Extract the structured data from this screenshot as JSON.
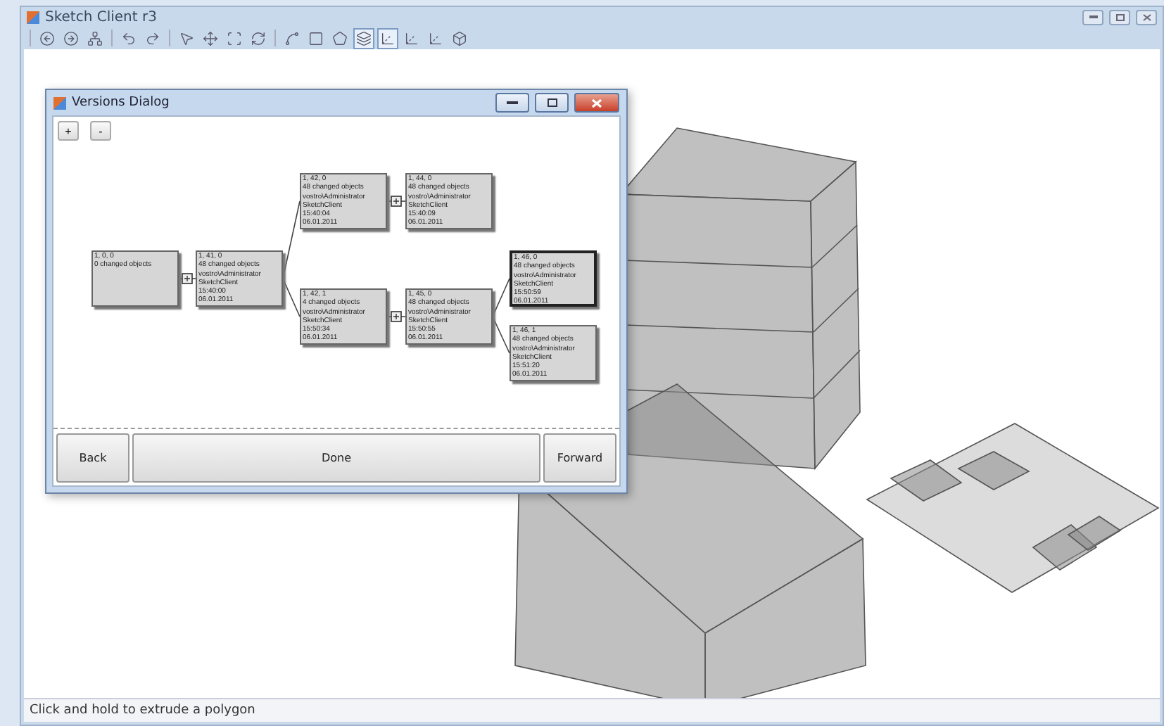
{
  "window": {
    "title": "Sketch Client r3"
  },
  "toolbar": [
    [
      {
        "kind": "back",
        "pressed": false
      },
      {
        "kind": "forward",
        "pressed": false
      },
      {
        "kind": "hierarchy",
        "pressed": false
      }
    ],
    [
      {
        "kind": "undo",
        "pressed": false
      },
      {
        "kind": "redo",
        "pressed": false
      }
    ],
    [
      {
        "kind": "pointer",
        "pressed": false
      },
      {
        "kind": "move",
        "pressed": false
      },
      {
        "kind": "fit",
        "pressed": false
      },
      {
        "kind": "rotate",
        "pressed": false
      }
    ],
    [
      {
        "kind": "freehand",
        "pressed": false
      },
      {
        "kind": "rectangle",
        "pressed": false
      },
      {
        "kind": "polygon",
        "pressed": false
      },
      {
        "kind": "layers",
        "pressed": true
      },
      {
        "kind": "axis",
        "pressed": true
      },
      {
        "kind": "axis",
        "pressed": false
      },
      {
        "kind": "axis",
        "pressed": false
      },
      {
        "kind": "solid",
        "pressed": false
      }
    ]
  ],
  "dialog": {
    "title": "Versions Dialog",
    "zoom_buttons": [
      "+",
      "-"
    ],
    "versions": [
      {
        "lines": [
          "1, 0, 0",
          "0 changed objects"
        ],
        "selected": false,
        "children": [
          {
            "lines": [
              "1, 41, 0",
              "48 changed objects",
              "vostro\\Administrator",
              "SketchClient",
              "15:40:00",
              "06.01.2011"
            ],
            "selected": false,
            "children": [
              {
                "lines": [
                  "1, 42, 0",
                  "48 changed objects",
                  "vostro\\Administrator",
                  "SketchClient",
                  "15:40:04",
                  "06.01.2011"
                ],
                "selected": false,
                "children": [
                  {
                    "lines": [
                      "1, 44, 0",
                      "48 changed objects",
                      "vostro\\Administrator",
                      "SketchClient",
                      "15:40:09",
                      "06.01.2011"
                    ],
                    "selected": false
                  }
                ]
              },
              {
                "lines": [
                  "1, 42, 1",
                  "4 changed objects",
                  "vostro\\Administrator",
                  "SketchClient",
                  "15:50:34",
                  "06.01.2011"
                ],
                "selected": false,
                "children": [
                  {
                    "lines": [
                      "1, 45, 0",
                      "48 changed objects",
                      "vostro\\Administrator",
                      "SketchClient",
                      "15:50:55",
                      "06.01.2011"
                    ],
                    "selected": false,
                    "children": [
                      {
                        "lines": [
                          "1, 46, 0",
                          "48 changed objects",
                          "vostro\\Administrator",
                          "SketchClient",
                          "15:50:59",
                          "06.01.2011"
                        ],
                        "selected": true
                      },
                      {
                        "lines": [
                          "1, 46, 1",
                          "48 changed objects",
                          "vostro\\Administrator",
                          "SketchClient",
                          "15:51:20",
                          "06.01.2011"
                        ],
                        "selected": false
                      }
                    ]
                  }
                ]
              }
            ]
          }
        ]
      }
    ],
    "buttons": [
      "Back",
      "Done",
      "Forward"
    ]
  },
  "status_bar": "Click and hold to extrude a polygon"
}
